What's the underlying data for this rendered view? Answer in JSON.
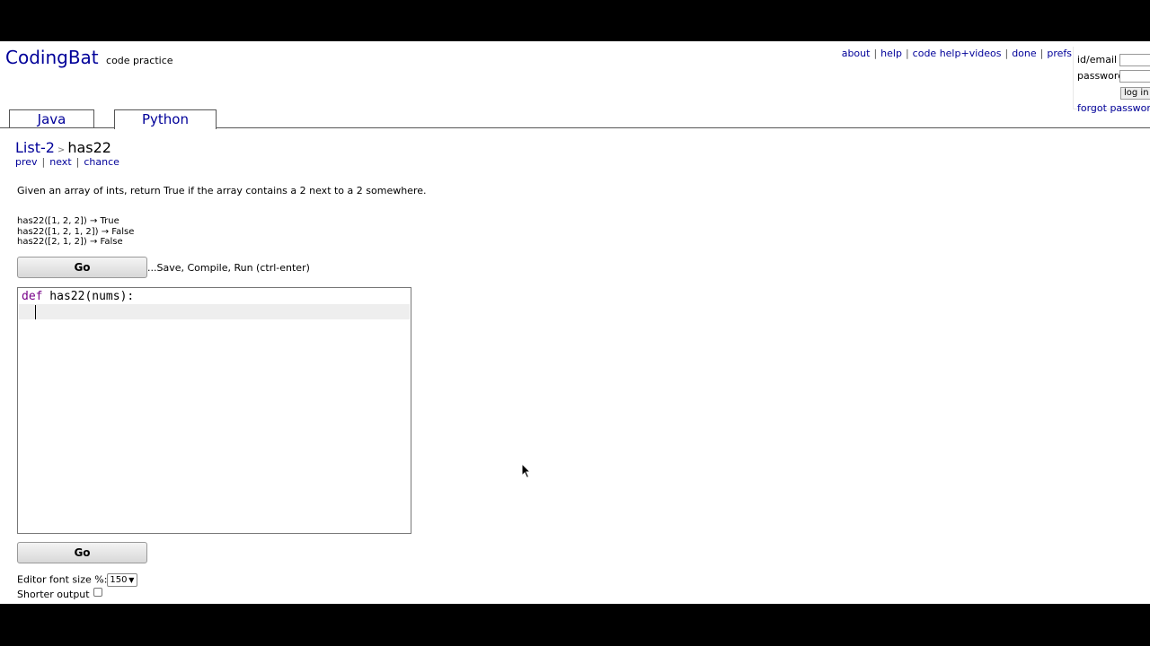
{
  "logo": {
    "name": "CodingBat",
    "tagline": "code practice"
  },
  "toplinks": [
    "about",
    "help",
    "code help+videos",
    "done",
    "prefs"
  ],
  "login": {
    "id_label": "id/email",
    "password_label": "password",
    "login_button": "log in",
    "forgot_label": "forgot password"
  },
  "tabs": [
    {
      "label": "Java",
      "active": false
    },
    {
      "label": "Python",
      "active": true
    }
  ],
  "breadcrumb": {
    "section": "List-2",
    "separator": ">",
    "problem": "has22"
  },
  "nav": {
    "prev": "prev",
    "next": "next",
    "chance": "chance",
    "sep": "|"
  },
  "problem": {
    "description": "Given an array of ints, return True if the array contains a 2 next to a 2 somewhere.",
    "examples": [
      "has22([1, 2, 2]) → True",
      "has22([1, 2, 1, 2]) → False",
      "has22([2, 1, 2]) → False"
    ]
  },
  "run": {
    "go_label": "Go",
    "hint": "...Save, Compile, Run (ctrl-enter)"
  },
  "editor": {
    "keyword": "def",
    "signature": " has22(nums):"
  },
  "settings": {
    "font_size_label": "Editor font size %:",
    "font_size_value": "150",
    "shorter_output_label": "Shorter output",
    "shorter_output_checked": false
  },
  "colors": {
    "link": "#000099",
    "keyword": "#770088",
    "active_line": "#eeeeee"
  }
}
